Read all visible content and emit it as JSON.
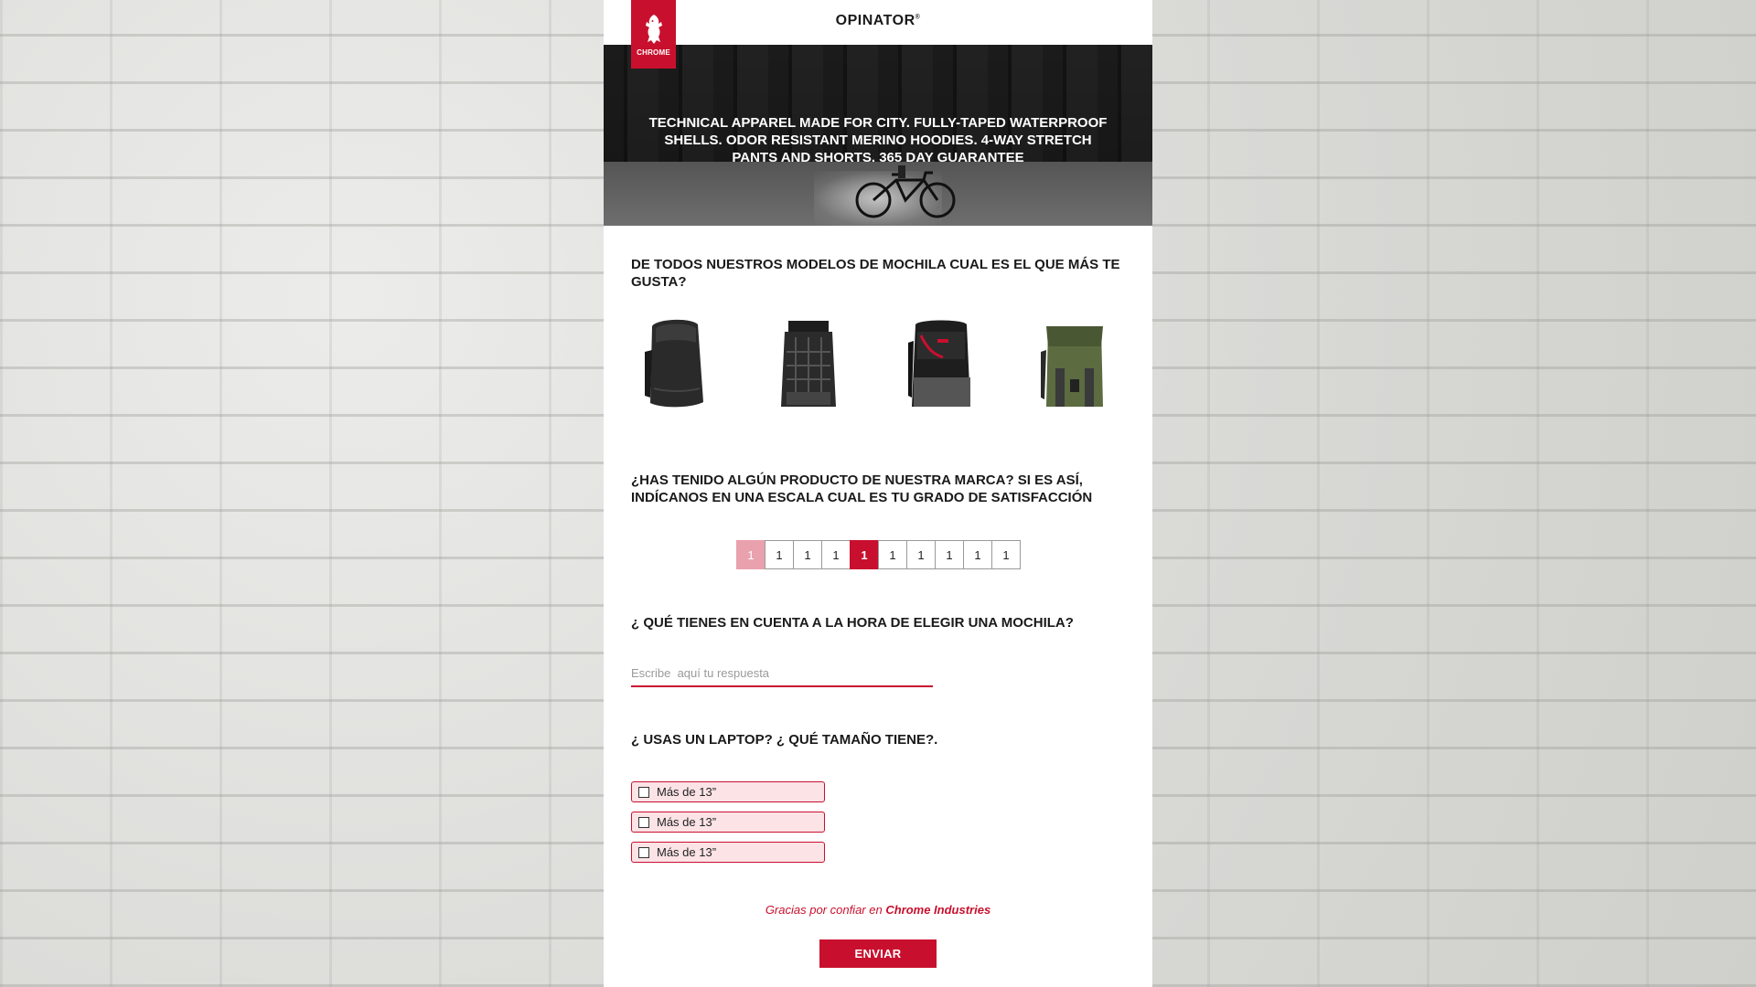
{
  "brand": {
    "logo_text": "CHROME",
    "header_title": "OPINATOR",
    "header_mark": "®",
    "accent_color": "#c8102e"
  },
  "hero": {
    "text": "TECHNICAL APPAREL MADE FOR CITY. FULLY-TAPED WATERPROOF SHELLS. ODOR RESISTANT MERINO HOODIES. 4-WAY STRETCH PANTS AND SHORTS. 365 DAY GUARANTEE"
  },
  "questions": {
    "q1": {
      "title": "DE TODOS NUESTROS MODELOS DE MOCHILA CUAL ES EL QUE MÁS TE GUSTA?",
      "options": [
        "black-rolltop-backpack",
        "black-molle-backpack",
        "black-red-backpack",
        "green-flap-backpack"
      ]
    },
    "q2": {
      "title": "¿HAS TENIDO ALGÚN PRODUCTO DE NUESTRA MARCA? SI ES ASÍ, INDÍCANOS EN UNA ESCALA CUAL ES TU GRADO DE SATISFACCIÓN",
      "scale": [
        "1",
        "1",
        "1",
        "1",
        "1",
        "1",
        "1",
        "1",
        "1",
        "1"
      ],
      "selected_index": 4
    },
    "q3": {
      "title": "¿ QUÉ TIENES EN CUENTA A LA HORA DE ELEGIR UNA MOCHILA?",
      "placeholder": "Escribe  aquí tu respuesta",
      "value": ""
    },
    "q4": {
      "title": "¿ USAS UN LAPTOP? ¿ QUÉ TAMAÑO TIENE?.",
      "options": [
        "Más de 13”",
        "Más de 13”",
        "Más de 13”"
      ]
    }
  },
  "footer": {
    "thanks_prefix": "Gracias por confiar en ",
    "thanks_brand": "Chrome Industries",
    "submit_label": "ENVIAR"
  }
}
